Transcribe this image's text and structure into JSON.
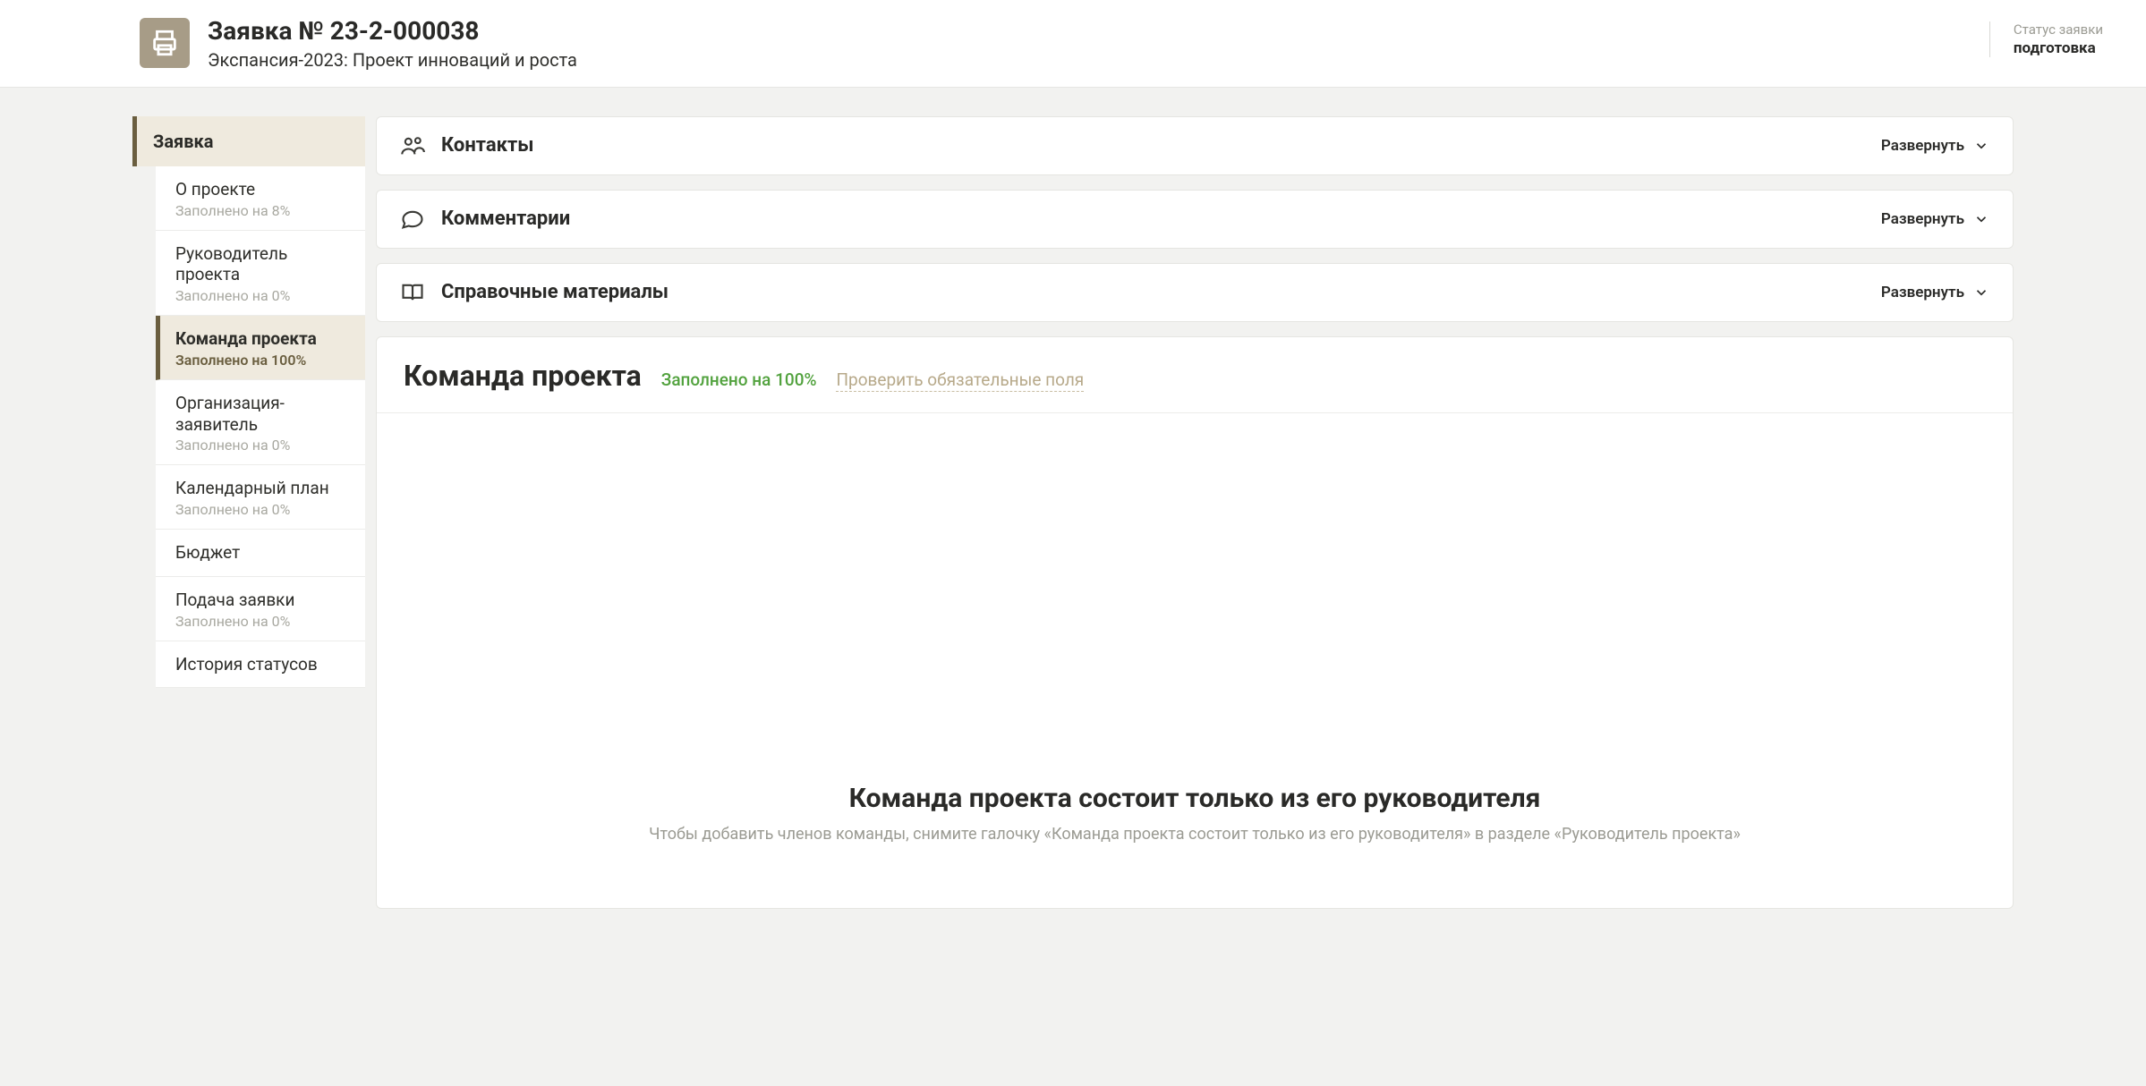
{
  "header": {
    "title": "Заявка № 23-2-000038",
    "subtitle": "Экспансия-2023: Проект инноваций и роста",
    "status_label": "Статус заявки",
    "status_value": "подготовка"
  },
  "sidebar": {
    "header": "Заявка",
    "items": [
      {
        "label": "О проекте",
        "progress": "Заполнено на 8%",
        "active": false
      },
      {
        "label": "Руководитель проекта",
        "progress": "Заполнено на 0%",
        "active": false
      },
      {
        "label": "Команда проекта",
        "progress": "Заполнено на 100%",
        "active": true
      },
      {
        "label": "Организация-заявитель",
        "progress": "Заполнено на 0%",
        "active": false
      },
      {
        "label": "Календарный план",
        "progress": "Заполнено на 0%",
        "active": false
      },
      {
        "label": "Бюджет",
        "progress": "",
        "active": false
      },
      {
        "label": "Подача заявки",
        "progress": "Заполнено на 0%",
        "active": false
      },
      {
        "label": "История статусов",
        "progress": "",
        "active": false
      }
    ]
  },
  "accordions": [
    {
      "title": "Контакты",
      "action": "Развернуть"
    },
    {
      "title": "Комментарии",
      "action": "Развернуть"
    },
    {
      "title": "Справочные материалы",
      "action": "Развернуть"
    }
  ],
  "content": {
    "heading": "Команда проекта",
    "progress": "Заполнено на 100%",
    "check_link": "Проверить обязательные поля",
    "empty_title": "Команда проекта состоит только из его руководителя",
    "empty_text": "Чтобы добавить членов команды, снимите галочку «Команда проекта состоит только из его руководителя» в разделе «Руководитель проекта»"
  }
}
